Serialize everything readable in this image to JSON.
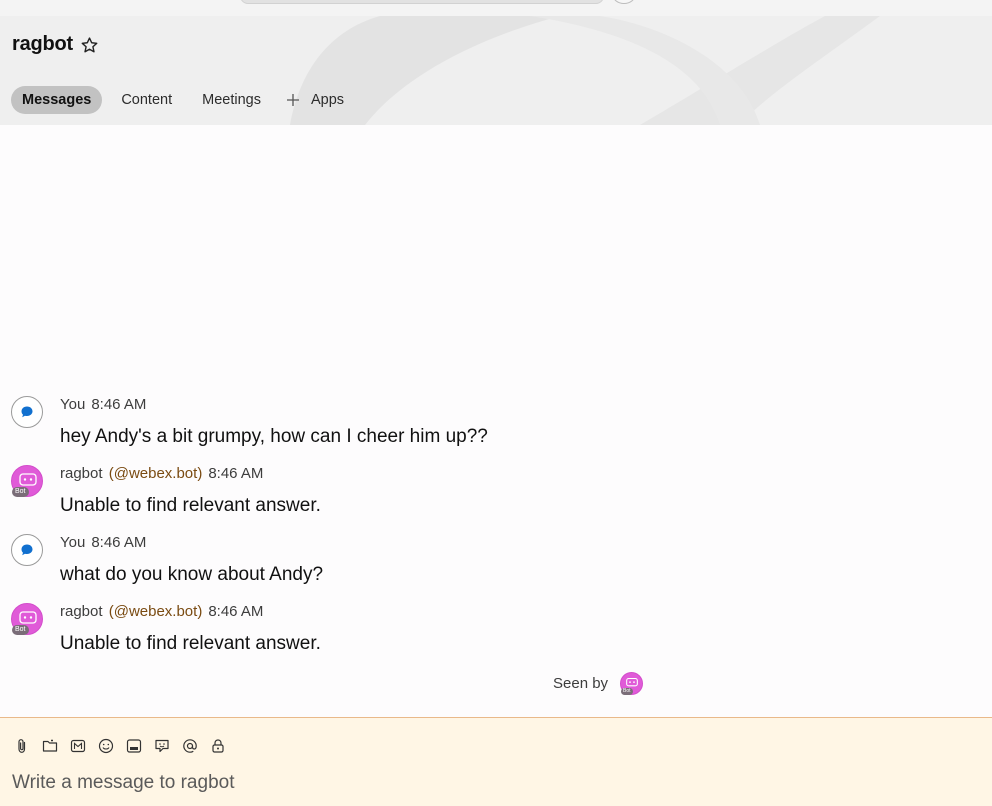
{
  "space": {
    "title": "ragbot"
  },
  "tabs": [
    {
      "label": "Messages",
      "active": true
    },
    {
      "label": "Content",
      "active": false
    },
    {
      "label": "Meetings",
      "active": false
    },
    {
      "label": "Apps",
      "active": false,
      "icon": "plus-icon"
    }
  ],
  "messages": [
    {
      "sender": "You",
      "handle": "",
      "time": "8:46 AM",
      "text": "hey Andy's a bit grumpy, how can I cheer him up??",
      "avatar": "chat-bubble-icon"
    },
    {
      "sender": "ragbot",
      "handle": "(@webex.bot)",
      "time": "8:46 AM",
      "text": "Unable to find relevant answer.",
      "avatar": "bot-icon",
      "badge": "Bot"
    },
    {
      "sender": "You",
      "handle": "",
      "time": "8:46 AM",
      "text": "what do you know about Andy?",
      "avatar": "chat-bubble-icon"
    },
    {
      "sender": "ragbot",
      "handle": "(@webex.bot)",
      "time": "8:46 AM",
      "text": "Unable to find relevant answer.",
      "avatar": "bot-icon",
      "badge": "Bot"
    }
  ],
  "seen": {
    "label": "Seen by",
    "badge": "Bot"
  },
  "composer": {
    "placeholder": "Write a message to ragbot",
    "tools": [
      "attach-icon",
      "folder-icon",
      "markdown-icon",
      "emoji-icon",
      "gif-icon",
      "sticker-icon",
      "mention-icon",
      "lock-icon"
    ]
  },
  "colors": {
    "bot_avatar": "#e05ad8",
    "handle": "#7a4b12",
    "composer_bg": "#fff6e5",
    "active_tab": "#c2c2c2"
  }
}
